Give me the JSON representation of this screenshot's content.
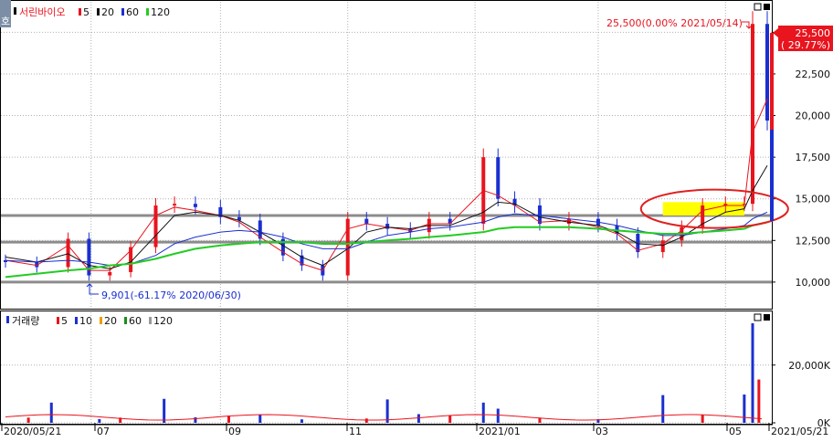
{
  "price_legend": {
    "name": "서린바이오",
    "ma": [
      {
        "label": "5",
        "color": "#e8141e"
      },
      {
        "label": "20",
        "color": "#111111"
      },
      {
        "label": "60",
        "color": "#1a2fd0"
      },
      {
        "label": "120",
        "color": "#22cc22"
      }
    ]
  },
  "volume_legend": {
    "name": "거래량",
    "ma": [
      {
        "label": "5",
        "color": "#e8141e"
      },
      {
        "label": "10",
        "color": "#1a2fd0"
      },
      {
        "label": "20",
        "color": "#e8a000"
      },
      {
        "label": "60",
        "color": "#1a8f1a"
      },
      {
        "label": "120",
        "color": "#999999"
      }
    ]
  },
  "annotations": {
    "high": "25,500(0.00% 2021/05/14)",
    "low": "9,901(-61.17% 2020/06/30)",
    "last_price": "25,500",
    "last_change": "( 29.77%)"
  },
  "side_tab_label": "호",
  "x_labels": [
    "2020/05/21",
    "07",
    "09",
    "11",
    "2021/01",
    "03",
    "05",
    "2021/05/21"
  ],
  "colors": {
    "up": "#e8141e",
    "down": "#1a2fd0",
    "support_line": "#8c8c8c",
    "highlight_box": "#ffff00",
    "ellipse": "#e02020",
    "grid": "#b0b0b0"
  },
  "chart_data": [
    {
      "type": "candlestick",
      "title": "서린바이오",
      "y_ticks": [
        "10,000",
        "12,500",
        "15,000",
        "17,500",
        "20,000",
        "22,500",
        "25,000"
      ],
      "ylim": [
        9500,
        26500
      ],
      "series": [
        {
          "name": "서린바이오",
          "x": [
            "2020-05-21",
            "2020-06-05",
            "2020-06-20",
            "2020-06-30",
            "2020-07-10",
            "2020-07-20",
            "2020-08-01",
            "2020-08-10",
            "2020-08-20",
            "2020-09-01",
            "2020-09-10",
            "2020-09-20",
            "2020-10-01",
            "2020-10-10",
            "2020-10-20",
            "2020-11-01",
            "2020-11-10",
            "2020-11-20",
            "2020-12-01",
            "2020-12-10",
            "2020-12-20",
            "2021-01-05",
            "2021-01-12",
            "2021-01-20",
            "2021-02-01",
            "2021-02-15",
            "2021-03-01",
            "2021-03-10",
            "2021-03-20",
            "2021-04-01",
            "2021-04-10",
            "2021-04-20",
            "2021-05-01",
            "2021-05-10",
            "2021-05-14",
            "2021-05-21"
          ],
          "close": [
            11200,
            10900,
            12600,
            10400,
            10600,
            12100,
            14600,
            14700,
            14500,
            13900,
            13700,
            12600,
            11600,
            11000,
            10400,
            13800,
            13500,
            13200,
            13000,
            13800,
            13500,
            17500,
            15000,
            14600,
            13500,
            13800,
            13400,
            12900,
            11800,
            12500,
            13300,
            14600,
            14700,
            14700,
            25500,
            19700
          ]
        },
        {
          "name": "5",
          "y": [
            11300,
            11000,
            12200,
            10700,
            10700,
            11900,
            14000,
            14500,
            14300,
            14000,
            13600,
            12700,
            11800,
            11100,
            10700,
            13200,
            13500,
            13300,
            13100,
            13500,
            13500,
            15500,
            15200,
            14600,
            13600,
            13700,
            13300,
            12900,
            11900,
            12300,
            13100,
            14300,
            14600,
            14600,
            19000,
            21000
          ]
        },
        {
          "name": "20",
          "y": [
            11500,
            11200,
            11700,
            11000,
            10800,
            11200,
            12800,
            14000,
            14200,
            14000,
            13700,
            13000,
            12200,
            11500,
            11000,
            12000,
            13000,
            13300,
            13200,
            13400,
            13400,
            14200,
            14800,
            14700,
            13900,
            13600,
            13400,
            13000,
            12300,
            12200,
            12700,
            13500,
            14200,
            14400,
            15500,
            17000
          ]
        },
        {
          "name": "60",
          "y": [
            11300,
            11200,
            11300,
            11200,
            11000,
            11100,
            11600,
            12300,
            12700,
            13000,
            13100,
            13000,
            12700,
            12300,
            12000,
            12000,
            12400,
            12800,
            13000,
            13200,
            13300,
            13600,
            13900,
            14100,
            14000,
            13800,
            13600,
            13400,
            13100,
            12800,
            12800,
            13000,
            13200,
            13400,
            13800,
            14200
          ]
        },
        {
          "name": "120",
          "y": [
            10300,
            10500,
            10700,
            10800,
            11000,
            11100,
            11400,
            11700,
            12000,
            12200,
            12300,
            12400,
            12400,
            12400,
            12300,
            12300,
            12400,
            12500,
            12600,
            12700,
            12800,
            13000,
            13200,
            13300,
            13300,
            13300,
            13200,
            13100,
            13000,
            12900,
            12900,
            13000,
            13100,
            13200,
            13400,
            13600
          ]
        }
      ],
      "support_lines": [
        14000,
        12400,
        10000
      ],
      "highlight_range": {
        "x": [
          "2021-04-01",
          "2021-05-10"
        ],
        "y": [
          14000,
          14800
        ]
      },
      "high": {
        "value": 25500,
        "date": "2021-05-14"
      },
      "low": {
        "value": 9901,
        "date": "2020-06-30"
      }
    },
    {
      "type": "bar",
      "title": "거래량",
      "y_ticks": [
        "0K",
        "20,000K"
      ],
      "ylim": [
        0,
        37000
      ],
      "unit": "K",
      "series": [
        {
          "name": "거래량",
          "x": [
            "2020-06-01",
            "2020-06-12",
            "2020-07-05",
            "2020-07-15",
            "2020-08-05",
            "2020-08-20",
            "2020-09-05",
            "2020-09-20",
            "2020-10-10",
            "2020-11-10",
            "2020-11-20",
            "2020-12-05",
            "2020-12-20",
            "2021-01-05",
            "2021-01-12",
            "2021-02-01",
            "2021-03-01",
            "2021-04-01",
            "2021-04-20",
            "2021-05-10",
            "2021-05-14",
            "2021-05-17"
          ],
          "values": [
            1800,
            7000,
            1300,
            1800,
            8300,
            1900,
            2500,
            2900,
            1200,
            1500,
            8100,
            3000,
            2600,
            7000,
            4900,
            1800,
            1300,
            9600,
            2700,
            9800,
            34500,
            15000
          ]
        }
      ]
    }
  ]
}
